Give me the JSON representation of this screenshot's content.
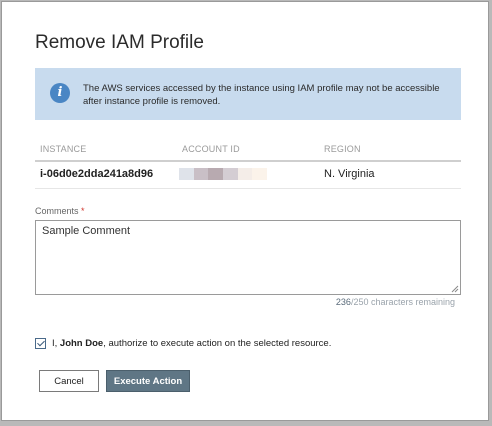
{
  "dialog": {
    "title": "Remove IAM Profile",
    "info_message": "The AWS services accessed by the instance using IAM profile may not be accessible after instance profile is removed.",
    "info_icon": "info-icon"
  },
  "table": {
    "headers": {
      "instance": "INSTANCE",
      "account_id": "ACCOUNT ID",
      "region": "REGION"
    },
    "row": {
      "instance": "i-06d0e2dda241a8d96",
      "account_id_redacted": true,
      "region": "N. Virginia"
    }
  },
  "comments": {
    "label": "Comments",
    "required_marker": "*",
    "value": "Sample Comment",
    "counter_count": "236",
    "counter_suffix": "/250 characters remaining"
  },
  "authorization": {
    "checked": true,
    "prefix": "I, ",
    "name": "John Doe",
    "suffix": ", authorize to execute action on the selected resource."
  },
  "buttons": {
    "cancel": "Cancel",
    "execute": "Execute Action"
  },
  "colors": {
    "info_banner": "#c8dbee",
    "info_icon": "#4a86c4",
    "execute_button": "#5f7685",
    "required": "#d0342c"
  }
}
